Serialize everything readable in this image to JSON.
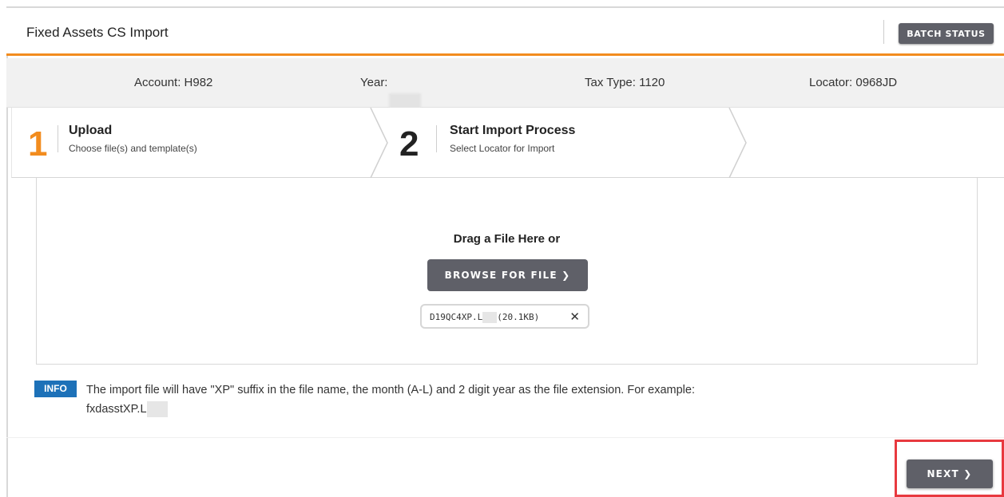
{
  "header": {
    "title": "Fixed Assets CS Import",
    "batch_status_label": "BATCH STATUS"
  },
  "infobar": {
    "account": "Account: H982",
    "year_label": "Year:",
    "tax_type": "Tax Type: 1120",
    "locator": "Locator: 0968JD"
  },
  "steps": [
    {
      "number": "1",
      "title": "Upload",
      "subtitle": "Choose file(s) and template(s)",
      "color": "#f28c1e"
    },
    {
      "number": "2",
      "title": "Start Import Process",
      "subtitle": "Select Locator for Import",
      "color": "#222222"
    }
  ],
  "dropzone": {
    "prompt": "Drag a File Here or",
    "browse_label": "BROWSE FOR FILE ❯",
    "file_name": "D19QC4XP.L",
    "file_size": "(20.1KB)",
    "remove_glyph": "✕"
  },
  "info": {
    "badge": "INFO",
    "text": "The import file will have \"XP\" suffix in the file name, the month (A-L) and 2 digit year as the file extension. For example:",
    "example": "fxdasstXP.L"
  },
  "footer": {
    "next_label": "NEXT ❯"
  },
  "colors": {
    "accent": "#f28c1e",
    "button": "#5f6068",
    "info_badge": "#1d71b8",
    "highlight": "#e8393f"
  }
}
